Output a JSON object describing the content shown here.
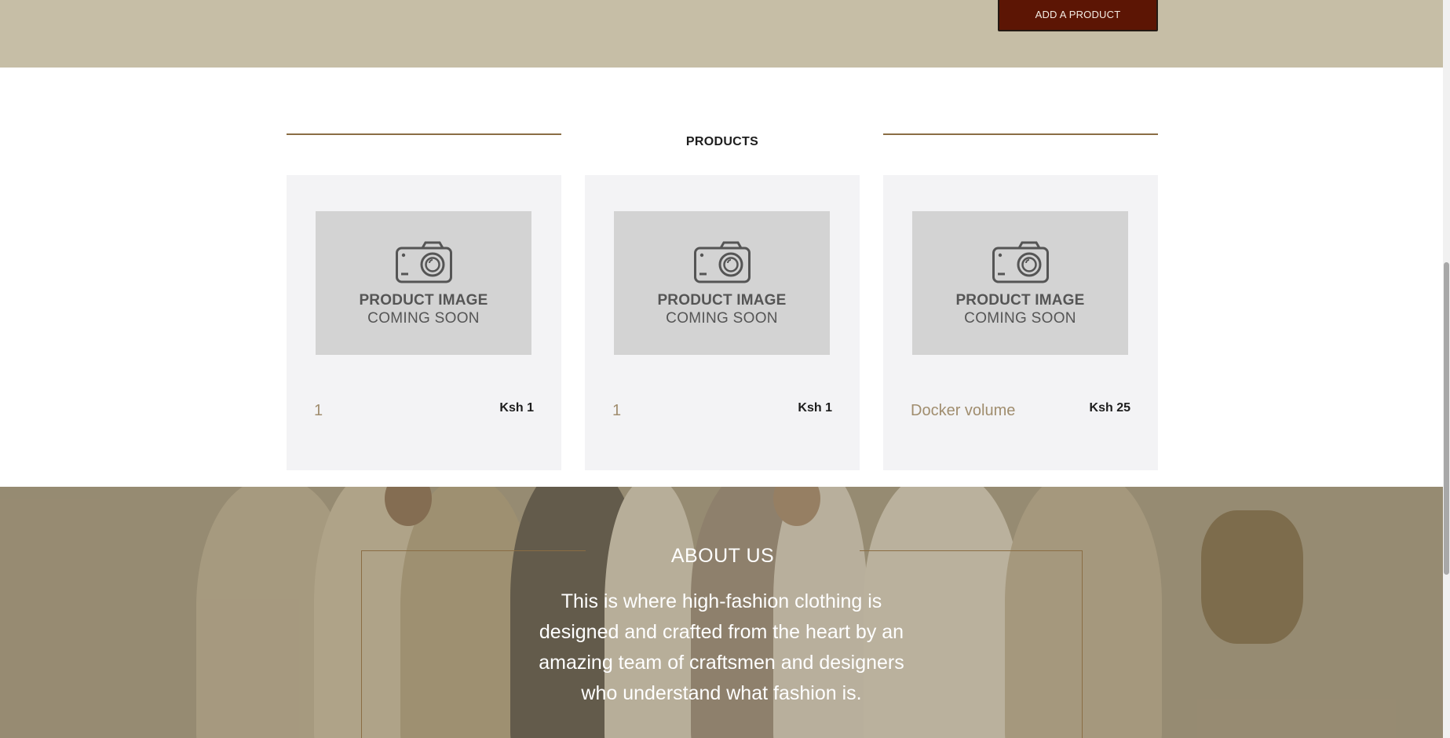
{
  "header": {
    "add_product_label": "ADD A PRODUCT"
  },
  "products": {
    "section_title": "PRODUCTS",
    "placeholder_line1": "PRODUCT IMAGE",
    "placeholder_line2": "COMING SOON",
    "items": [
      {
        "name": "1",
        "price": "Ksh 1",
        "image_icon": "camera-icon"
      },
      {
        "name": "1",
        "price": "Ksh 1",
        "image_icon": "camera-icon"
      },
      {
        "name": "Docker volume",
        "price": "Ksh 25",
        "image_icon": "camera-icon"
      }
    ]
  },
  "about": {
    "title": "ABOUT US",
    "text": "This is where high-fashion clothing is designed and crafted from the heart by an amazing team of craftsmen and designers who understand what fashion is."
  },
  "colors": {
    "top_band": "#c6bea6",
    "button_bg": "#5c1504",
    "accent_rule": "#8a6d44",
    "product_name": "#a08d6e",
    "card_bg": "#f3f3f5",
    "placeholder_bg": "#d3d3d3"
  }
}
